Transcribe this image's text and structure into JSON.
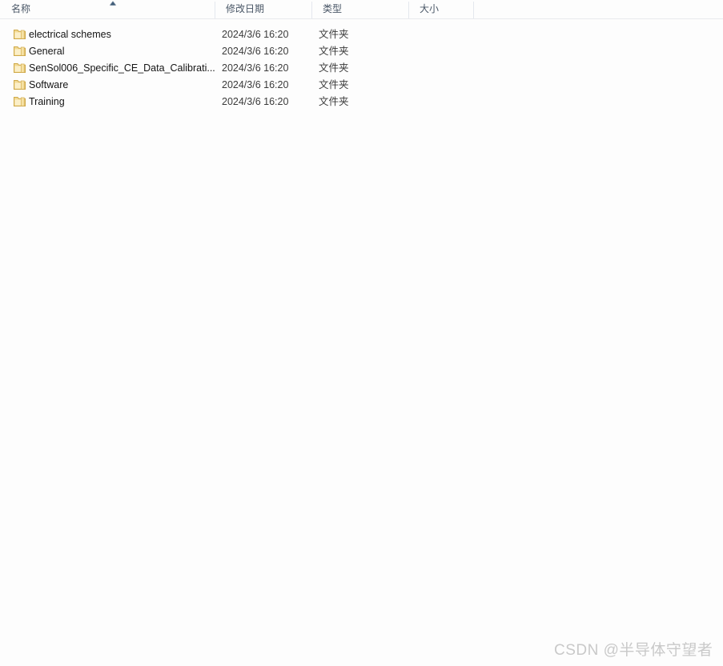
{
  "columns": {
    "name": "名称",
    "date_modified": "修改日期",
    "type": "类型",
    "size": "大小"
  },
  "sort": {
    "column": "名称",
    "direction": "ascending",
    "indicator_icon": "sort-ascending-icon",
    "indicator_color": "#44617f"
  },
  "files": [
    {
      "name": "electrical schemes",
      "date_modified": "2024/3/6 16:20",
      "type": "文件夹",
      "size": "",
      "icon": "folder-icon"
    },
    {
      "name": "General",
      "date_modified": "2024/3/6 16:20",
      "type": "文件夹",
      "size": "",
      "icon": "folder-icon"
    },
    {
      "name": "SenSol006_Specific_CE_Data_Calibrati...",
      "date_modified": "2024/3/6 16:20",
      "type": "文件夹",
      "size": "",
      "icon": "folder-icon"
    },
    {
      "name": "Software",
      "date_modified": "2024/3/6 16:20",
      "type": "文件夹",
      "size": "",
      "icon": "folder-icon"
    },
    {
      "name": "Training",
      "date_modified": "2024/3/6 16:20",
      "type": "文件夹",
      "size": "",
      "icon": "folder-icon"
    }
  ],
  "watermark": {
    "text": "CSDN @半导体守望者"
  },
  "colors": {
    "background": "#fdfdfd",
    "header_text": "#4a5767",
    "row_text": "#141414",
    "meta_text": "#3b3b3b",
    "divider": "#e4e7ee",
    "folder_body": "#f7dd9a",
    "folder_edge": "#d9b558",
    "watermark": "#c9c9c9"
  }
}
